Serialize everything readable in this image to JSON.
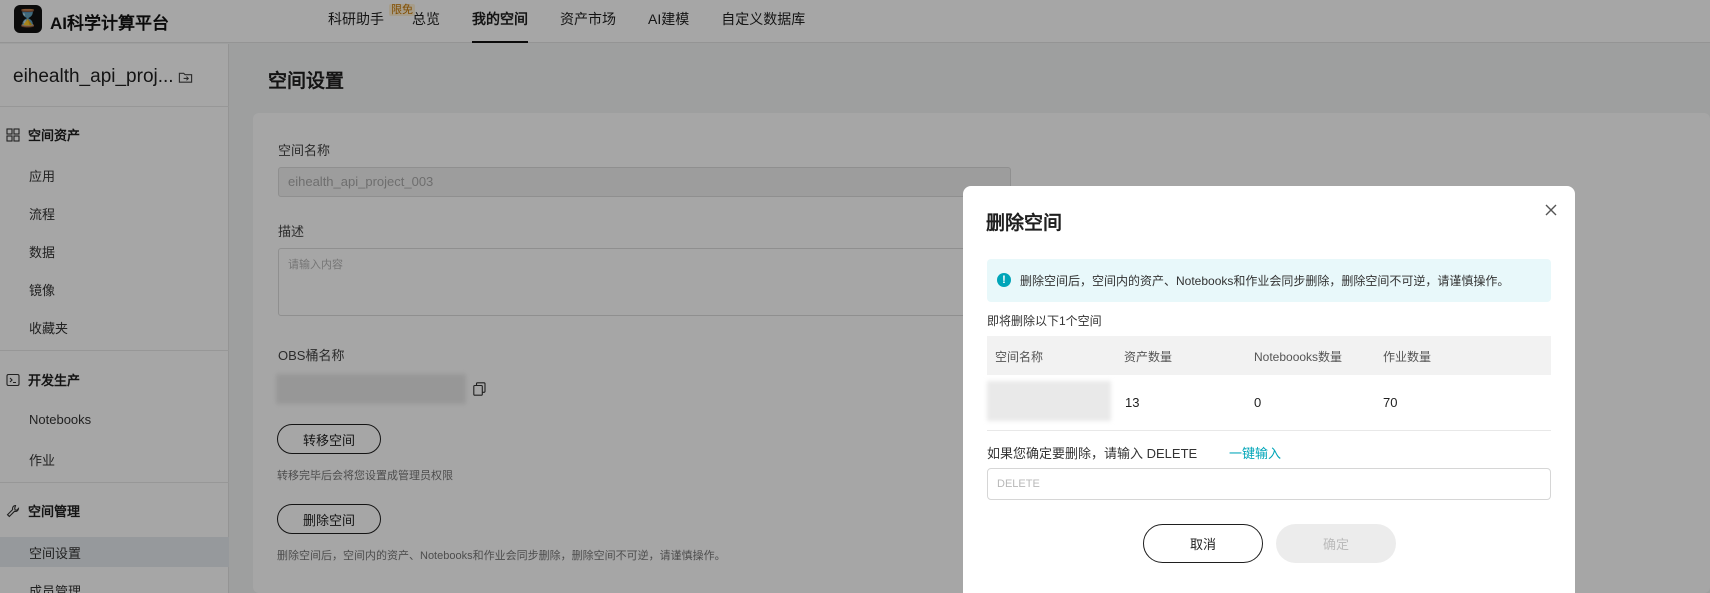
{
  "header": {
    "logo_glyph": "⌛",
    "app_title": "AI科学计算平台",
    "nav": [
      {
        "label": "科研助手",
        "badge": "限免"
      },
      {
        "label": "总览"
      },
      {
        "label": "我的空间",
        "active": true
      },
      {
        "label": "资产市场"
      },
      {
        "label": "AI建模"
      },
      {
        "label": "自定义数据库"
      }
    ]
  },
  "sidebar": {
    "project_name": "eihealth_api_proj...",
    "groups": [
      {
        "title": "空间资产",
        "items": [
          "应用",
          "流程",
          "数据",
          "镜像",
          "收藏夹"
        ]
      },
      {
        "title": "开发生产",
        "items": [
          "Notebooks",
          "作业"
        ]
      },
      {
        "title": "空间管理",
        "items": [
          "空间设置",
          "成员管理"
        ]
      }
    ],
    "active_item": "空间设置"
  },
  "main": {
    "page_title": "空间设置",
    "space_name_label": "空间名称",
    "space_name_value": "eihealth_api_project_003",
    "description_label": "描述",
    "description_placeholder": "请输入内容",
    "obs_label": "OBS桶名称",
    "transfer_button": "转移空间",
    "transfer_hint": "转移完毕后会将您设置成管理员权限",
    "delete_button": "删除空间",
    "delete_hint": "删除空间后，空间内的资产、Notebooks和作业会同步删除，删除空间不可逆，请谨慎操作。"
  },
  "dialog": {
    "title": "删除空间",
    "alert": "删除空间后，空间内的资产、Notebooks和作业会同步删除，删除空间不可逆，请谨慎操作。",
    "subtitle": "即将删除以下1个空间",
    "columns": [
      "空间名称",
      "资产数量",
      "Noteboooks数量",
      "作业数量"
    ],
    "row": {
      "assets": "13",
      "notebooks": "0",
      "jobs": "70"
    },
    "confirm_prompt": "如果您确定要删除，请输入 DELETE",
    "quick_input": "一键输入",
    "input_placeholder": "DELETE",
    "cancel": "取消",
    "ok": "确定"
  }
}
